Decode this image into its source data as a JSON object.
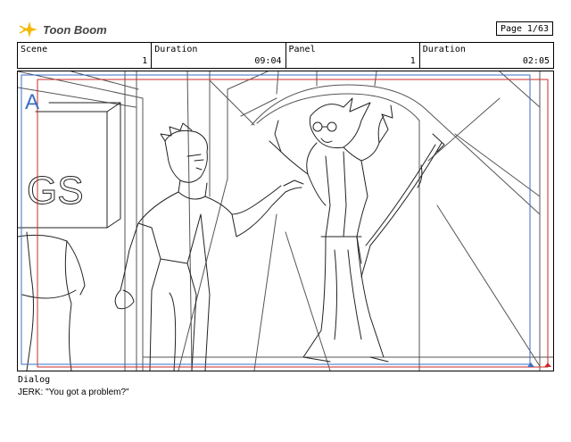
{
  "logo": {
    "text": "Toon Boom",
    "icon": "toon-boom-star-icon"
  },
  "page": {
    "label": "Page",
    "value": "1/63"
  },
  "info": {
    "scene_label": "Scene",
    "scene_value": "1",
    "duration_label": "Duration",
    "duration_value": "09:04",
    "panel_label": "Panel",
    "panel_value": "1",
    "panel_duration_label": "Duration",
    "panel_duration_value": "02:05"
  },
  "panel_sketch": {
    "marker_letter": "A",
    "sign_text": "GS"
  },
  "dialog": {
    "label": "Dialog",
    "text": "JERK: \"You got a problem?\""
  },
  "colors": {
    "safe_frame_red": "#cc2a2a",
    "safe_frame_blue": "#3a6fc4",
    "logo_yellow": "#f5b800"
  }
}
